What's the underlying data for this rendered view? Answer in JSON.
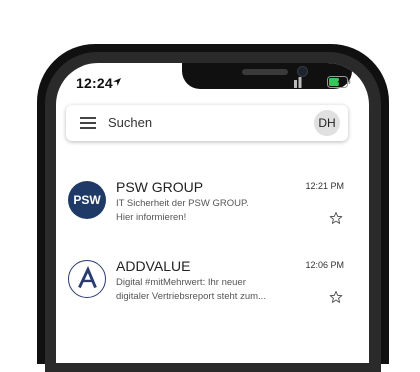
{
  "status_bar": {
    "time": "12:24"
  },
  "search": {
    "placeholder": "Suchen",
    "avatar_initials": "DH"
  },
  "emails": [
    {
      "sender": "PSW GROUP",
      "logo_text": "PSW",
      "time": "12:21 PM",
      "preview_line1": "IT Sicherheit der PSW GROUP.",
      "preview_line2": "Hier informieren!"
    },
    {
      "sender": "ADDVALUE",
      "time": "12:06 PM",
      "preview_line1": "Digital #mitMehrwert: Ihr neuer",
      "preview_line2": "digitaler Vertriebsreport steht zum..."
    }
  ],
  "colors": {
    "psw_logo_bg": "#1f3a66",
    "battery_green": "#34c759",
    "addvalue_logo": "#2a3c6e"
  }
}
